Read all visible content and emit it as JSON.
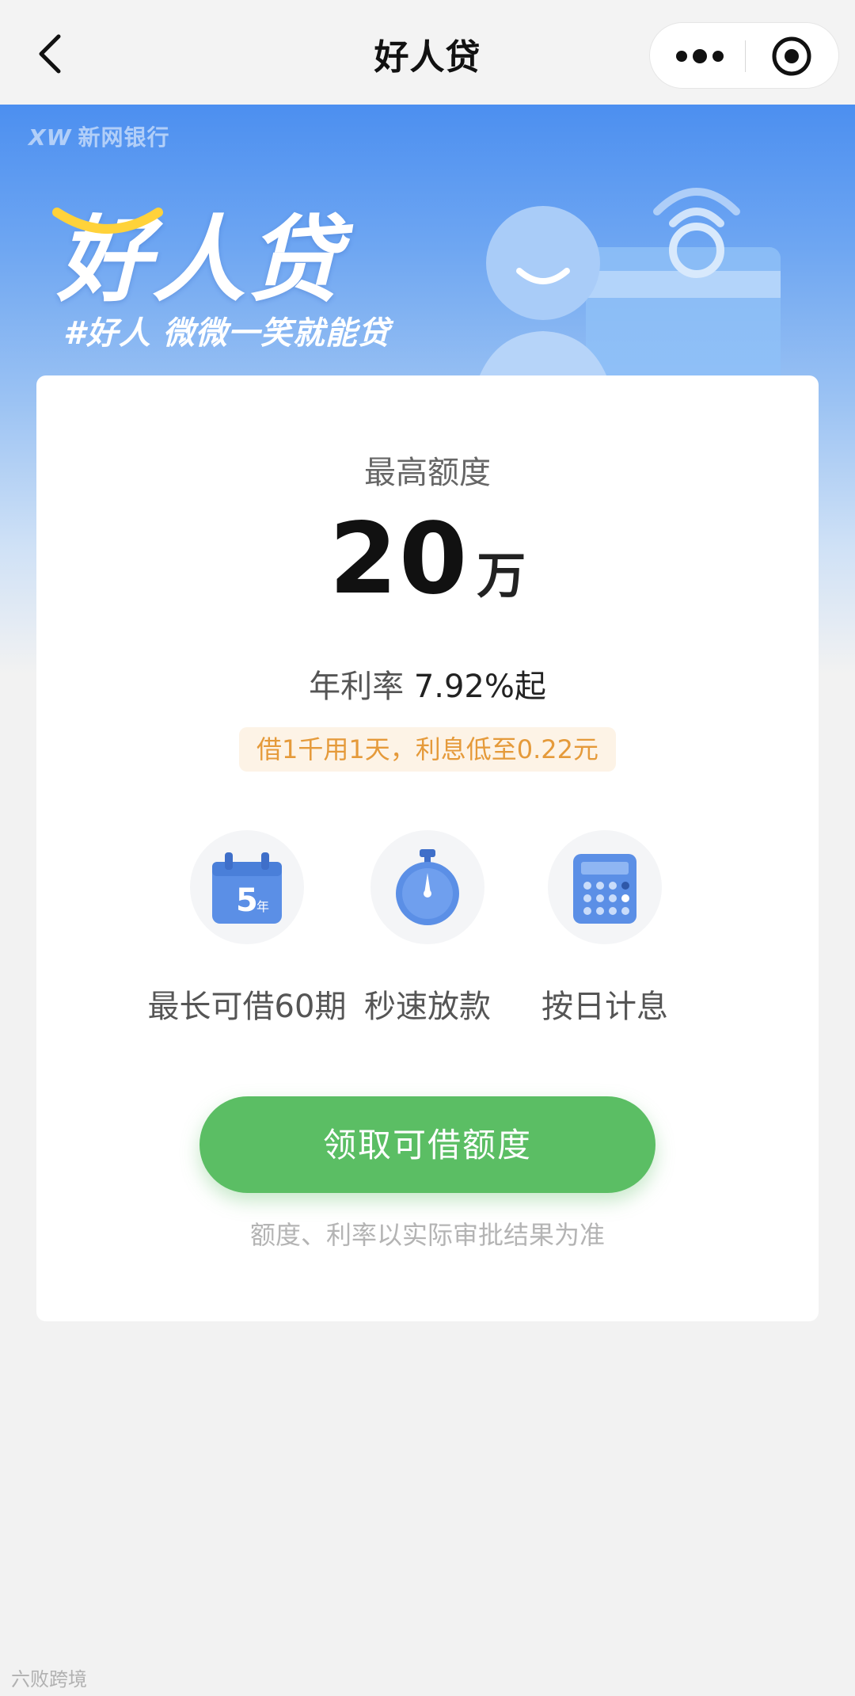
{
  "nav": {
    "title": "好人贷"
  },
  "hero": {
    "bank_logo_mark": "XW",
    "bank_logo_name": "新网银行",
    "brand_title": "好人贷",
    "slogan": "#好人  微微一笑就能贷"
  },
  "card": {
    "limit_label": "最高额度",
    "limit_value": "20",
    "limit_unit": "万",
    "rate_label": "年利率",
    "rate_value": "7.92%起",
    "promo": "借1千用1天，利息低至0.22元",
    "features": [
      {
        "label": "最长可借60期",
        "icon": "calendar-icon",
        "icon_text": "5",
        "icon_subtext": "年"
      },
      {
        "label": "秒速放款",
        "icon": "stopwatch-icon"
      },
      {
        "label": "按日计息",
        "icon": "calculator-icon"
      }
    ],
    "cta_label": "领取可借额度",
    "disclaimer": "额度、利率以实际审批结果为准"
  },
  "watermark": "六败跨境",
  "colors": {
    "primary_blue": "#4c8ff0",
    "cta_green": "#5bbe64",
    "promo_orange": "#e59a3a"
  }
}
